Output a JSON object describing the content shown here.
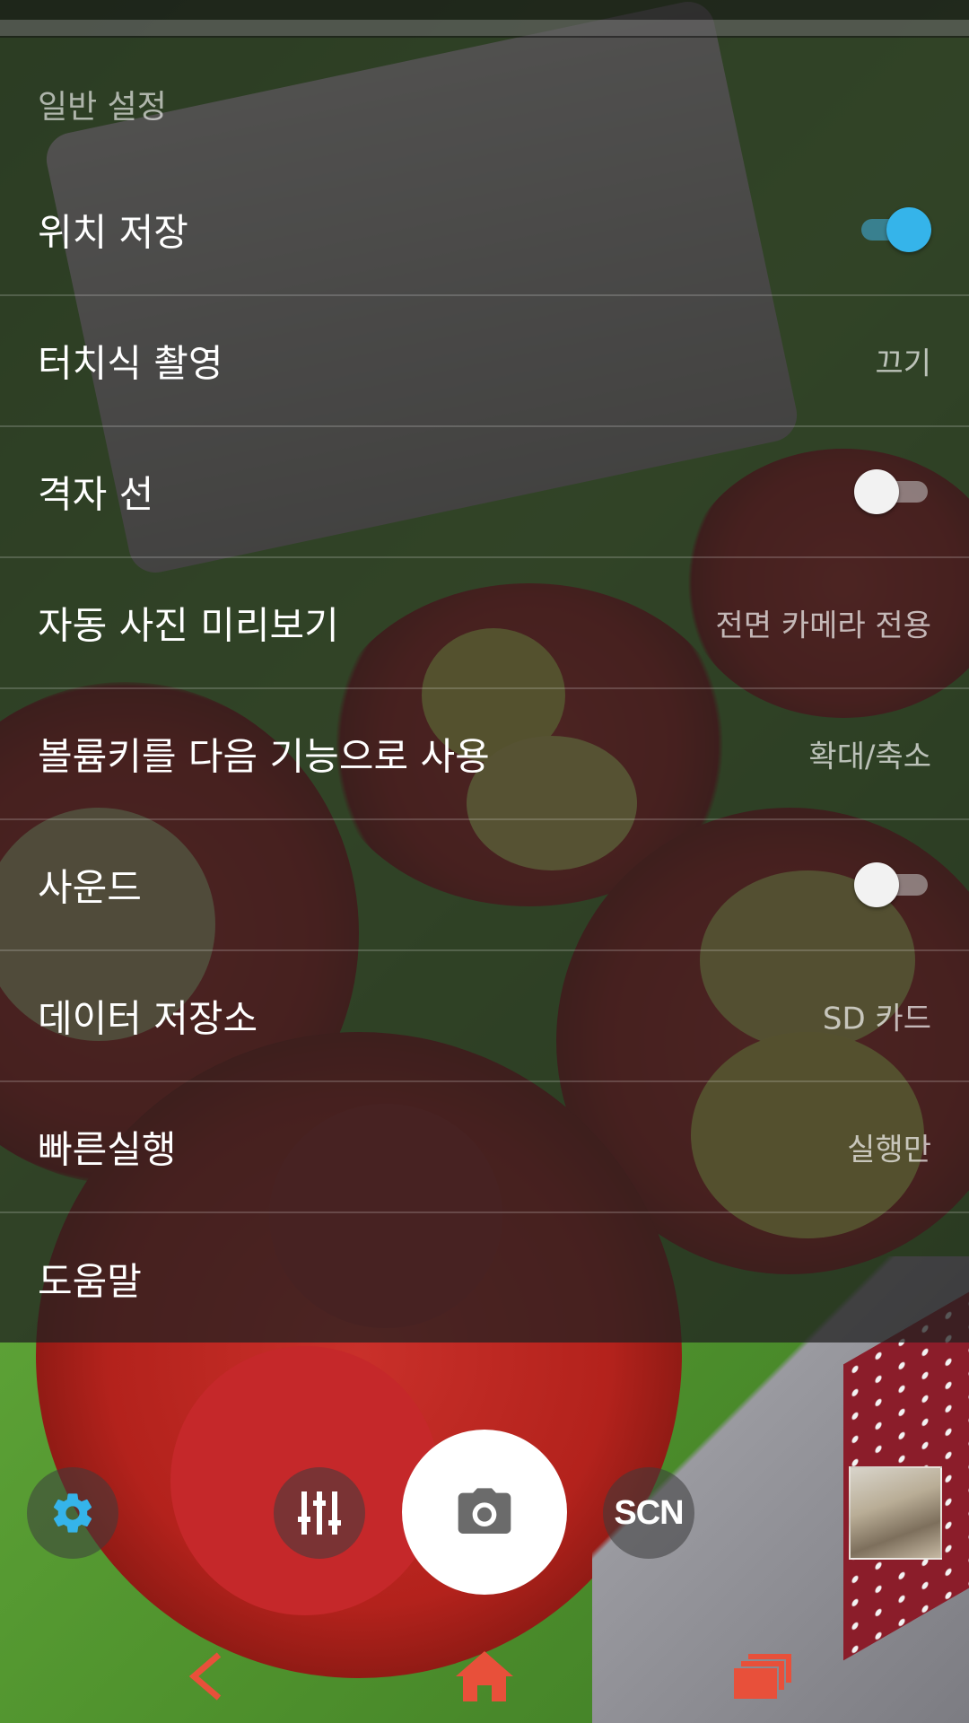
{
  "settings": {
    "section_title": "일반 설정",
    "items": [
      {
        "label": "위치 저장",
        "type": "toggle",
        "state": "on"
      },
      {
        "label": "터치식 촬영",
        "type": "value",
        "value": "끄기"
      },
      {
        "label": "격자 선",
        "type": "toggle",
        "state": "off"
      },
      {
        "label": "자동 사진 미리보기",
        "type": "value",
        "value": "전면 카메라 전용"
      },
      {
        "label": "볼륨키를 다음 기능으로 사용",
        "type": "value",
        "value": "확대/축소"
      },
      {
        "label": "사운드",
        "type": "toggle",
        "state": "off"
      },
      {
        "label": "데이터 저장소",
        "type": "value",
        "value": "SD 카드"
      },
      {
        "label": "빠른실행",
        "type": "value",
        "value": "실행만"
      },
      {
        "label": "도움말",
        "type": "link"
      }
    ]
  },
  "controls": {
    "scene_label": "SCN",
    "icons": [
      "gear-icon",
      "sliders-icon",
      "camera-icon",
      "scene-icon"
    ]
  },
  "navbar": {
    "icons": [
      "back-icon",
      "home-icon",
      "recent-apps-icon"
    ]
  },
  "colors": {
    "accent": "#35b4ea",
    "nav_accent": "#e8503a",
    "panel_bg": "rgba(33,33,33,0.74)"
  }
}
